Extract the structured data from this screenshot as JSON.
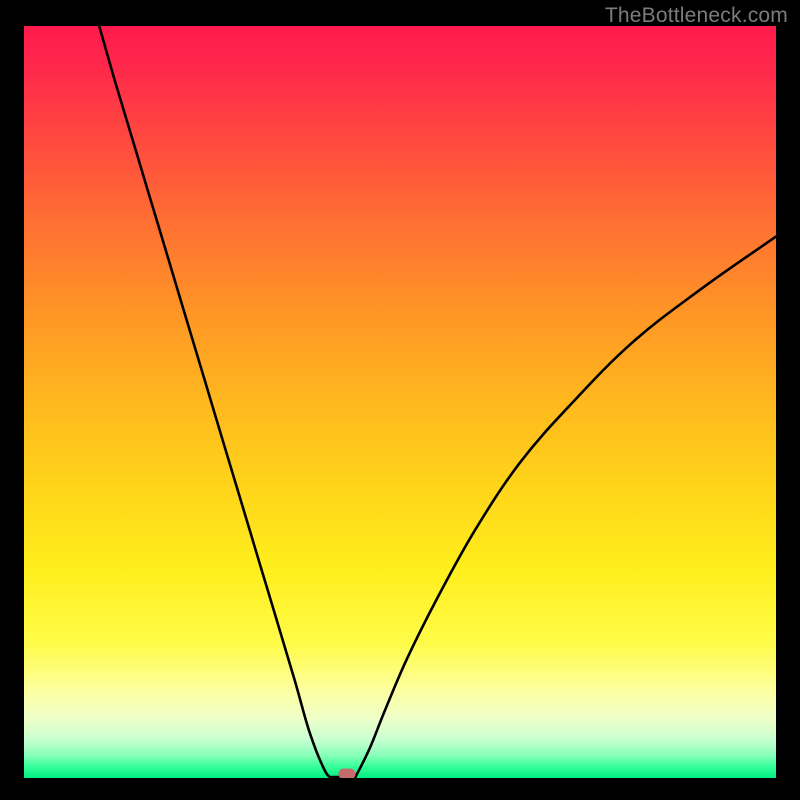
{
  "watermark_text": "TheBottleneck.com",
  "colors": {
    "frame_bg": "#000000",
    "watermark": "#7c7c7c",
    "curve_stroke": "#000000",
    "marker_fill": "#c56a6e",
    "gradient_top": "#ff1a4d",
    "gradient_bottom": "#00ef81"
  },
  "chart_data": {
    "type": "line",
    "title": "",
    "xlabel": "",
    "ylabel": "",
    "xlim": [
      0,
      100
    ],
    "ylim": [
      0,
      100
    ],
    "grid": false,
    "legend": false,
    "annotations": [],
    "notes": "V-shaped bottleneck curve. Both branches rise steeply away from the minimum; left branch is steeper and reaches ~100 at x≈10, right branch reaches ~72 at x=100. Minimum (value ≈0) occurs around x≈41–43.",
    "minimum": {
      "x": 42,
      "y": 0
    },
    "marker": {
      "x": 43,
      "y": 0,
      "shape": "rounded-rect",
      "color": "#c56a6e"
    },
    "series": [
      {
        "name": "left-branch",
        "x": [
          10,
          12,
          15,
          18,
          21,
          24,
          27,
          30,
          33,
          36,
          38,
          40,
          41
        ],
        "y": [
          100,
          93,
          83,
          73,
          63,
          53,
          43,
          33,
          23,
          13,
          6,
          1,
          0
        ]
      },
      {
        "name": "right-branch",
        "x": [
          44,
          46,
          48,
          51,
          55,
          60,
          66,
          73,
          81,
          90,
          100
        ],
        "y": [
          0,
          4,
          9,
          16,
          24,
          33,
          42,
          50,
          58,
          65,
          72
        ]
      }
    ]
  }
}
